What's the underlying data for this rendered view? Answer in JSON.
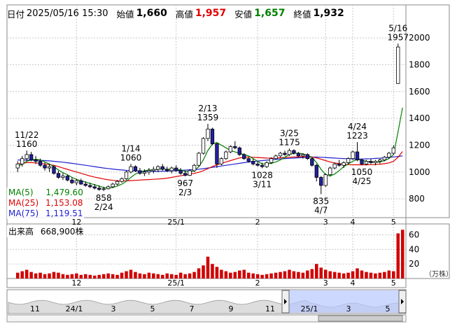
{
  "header": {
    "date_label": "日付",
    "date_value": "2025/05/16 15:30",
    "open_label": "始値",
    "open_value": "1,660",
    "high_label": "高値",
    "high_value": "1,957",
    "low_label": "安値",
    "low_value": "1,657",
    "close_label": "終値",
    "close_value": "1,932"
  },
  "ma_legend": [
    {
      "label": "MA(5)",
      "value": "1,479.60",
      "color": "#008000"
    },
    {
      "label": "MA(25)",
      "value": "1,153.08",
      "color": "#e00000"
    },
    {
      "label": "MA(75)",
      "value": "1,119.51",
      "color": "#2020d0"
    }
  ],
  "volume_legend": {
    "label": "出来高",
    "value": "668,900株"
  },
  "volume_unit": "（万株）",
  "colors": {
    "up": "#e00000",
    "down": "#2020a0",
    "ma5": "#008000",
    "ma25": "#e00000",
    "ma75": "#2020d0",
    "volume": "#d00000",
    "grid": "#c8c8c8"
  },
  "chart_data": [
    {
      "type": "candlestick",
      "title": "",
      "ylim": [
        660,
        2110
      ],
      "y_ticks": [
        "800",
        "1000",
        "1200",
        "1400",
        "1600",
        "1800",
        "2000"
      ],
      "x_ticks": [
        "12",
        "25/1",
        "2",
        "3",
        "4",
        "5"
      ],
      "grid": true,
      "annotations": [
        {
          "date": "11/22",
          "value": "1160",
          "kind": "high"
        },
        {
          "date": "2/24",
          "value": "858",
          "kind": "low"
        },
        {
          "date": "1/14",
          "value": "1060",
          "kind": "high"
        },
        {
          "date": "2/3",
          "value": "967",
          "kind": "low"
        },
        {
          "date": "2/13",
          "value": "1359",
          "kind": "high"
        },
        {
          "date": "3/11",
          "value": "1028",
          "kind": "low"
        },
        {
          "date": "3/25",
          "value": "1175",
          "kind": "high"
        },
        {
          "date": "4/7",
          "value": "835",
          "kind": "low"
        },
        {
          "date": "4/24",
          "value": "1223",
          "kind": "high"
        },
        {
          "date": "4/25",
          "value": "1050",
          "kind": "low"
        },
        {
          "date": "5/16",
          "value": "1957",
          "kind": "high"
        }
      ],
      "candles": [
        [
          1030,
          1080,
          1000,
          1060
        ],
        [
          1060,
          1120,
          1040,
          1100
        ],
        [
          1100,
          1160,
          1080,
          1130
        ],
        [
          1130,
          1150,
          1080,
          1090
        ],
        [
          1090,
          1120,
          1060,
          1080
        ],
        [
          1080,
          1100,
          1040,
          1050
        ],
        [
          1050,
          1070,
          1010,
          1030
        ],
        [
          1030,
          1060,
          1000,
          1040
        ],
        [
          1040,
          1050,
          980,
          990
        ],
        [
          990,
          1010,
          950,
          960
        ],
        [
          960,
          990,
          940,
          970
        ],
        [
          970,
          980,
          930,
          940
        ],
        [
          940,
          960,
          910,
          920
        ],
        [
          920,
          950,
          900,
          935
        ],
        [
          935,
          950,
          905,
          910
        ],
        [
          910,
          930,
          890,
          900
        ],
        [
          900,
          920,
          880,
          890
        ],
        [
          890,
          910,
          870,
          880
        ],
        [
          880,
          900,
          860,
          870
        ],
        [
          870,
          890,
          858,
          875
        ],
        [
          875,
          900,
          870,
          890
        ],
        [
          890,
          920,
          880,
          910
        ],
        [
          910,
          940,
          900,
          930
        ],
        [
          930,
          960,
          920,
          950
        ],
        [
          950,
          1010,
          940,
          1000
        ],
        [
          1000,
          1060,
          990,
          1040
        ],
        [
          1040,
          1050,
          1000,
          1010
        ],
        [
          1010,
          1030,
          980,
          990
        ],
        [
          990,
          1020,
          970,
          1000
        ],
        [
          1000,
          1030,
          980,
          1010
        ],
        [
          1010,
          1040,
          990,
          1020
        ],
        [
          1020,
          1050,
          1000,
          1040
        ],
        [
          1040,
          1060,
          1010,
          1020
        ],
        [
          1020,
          1040,
          1000,
          1010
        ],
        [
          1010,
          1040,
          990,
          1030
        ],
        [
          1030,
          1050,
          1000,
          1010
        ],
        [
          1010,
          1030,
          980,
          990
        ],
        [
          990,
          1010,
          967,
          975
        ],
        [
          975,
          1020,
          970,
          1010
        ],
        [
          1010,
          1060,
          1000,
          1050
        ],
        [
          1050,
          1150,
          1040,
          1140
        ],
        [
          1140,
          1260,
          1130,
          1250
        ],
        [
          1250,
          1359,
          1230,
          1320
        ],
        [
          1320,
          1330,
          1200,
          1210
        ],
        [
          1210,
          1220,
          1030,
          1060
        ],
        [
          1060,
          1110,
          1050,
          1100
        ],
        [
          1100,
          1160,
          1090,
          1150
        ],
        [
          1150,
          1200,
          1140,
          1190
        ],
        [
          1190,
          1230,
          1170,
          1180
        ],
        [
          1180,
          1190,
          1120,
          1130
        ],
        [
          1130,
          1140,
          1090,
          1100
        ],
        [
          1100,
          1110,
          1070,
          1080
        ],
        [
          1080,
          1100,
          1050,
          1060
        ],
        [
          1060,
          1080,
          1040,
          1050
        ],
        [
          1050,
          1070,
          1028,
          1040
        ],
        [
          1040,
          1080,
          1030,
          1070
        ],
        [
          1070,
          1110,
          1060,
          1100
        ],
        [
          1100,
          1130,
          1090,
          1120
        ],
        [
          1120,
          1150,
          1110,
          1140
        ],
        [
          1140,
          1160,
          1120,
          1130
        ],
        [
          1130,
          1175,
          1120,
          1160
        ],
        [
          1160,
          1170,
          1130,
          1140
        ],
        [
          1140,
          1150,
          1110,
          1120
        ],
        [
          1120,
          1140,
          1100,
          1130
        ],
        [
          1130,
          1140,
          1090,
          1100
        ],
        [
          1100,
          1110,
          1040,
          1050
        ],
        [
          1050,
          1060,
          930,
          960
        ],
        [
          960,
          970,
          835,
          900
        ],
        [
          900,
          990,
          890,
          980
        ],
        [
          980,
          1040,
          970,
          1030
        ],
        [
          1030,
          1070,
          1020,
          1060
        ],
        [
          1060,
          1090,
          1040,
          1050
        ],
        [
          1050,
          1080,
          1030,
          1070
        ],
        [
          1070,
          1110,
          1060,
          1100
        ],
        [
          1100,
          1160,
          1090,
          1150
        ],
        [
          1150,
          1223,
          1080,
          1090
        ],
        [
          1090,
          1100,
          1050,
          1060
        ],
        [
          1060,
          1090,
          1050,
          1080
        ],
        [
          1080,
          1100,
          1060,
          1070
        ],
        [
          1070,
          1090,
          1050,
          1080
        ],
        [
          1080,
          1100,
          1060,
          1090
        ],
        [
          1090,
          1120,
          1080,
          1110
        ],
        [
          1110,
          1150,
          1100,
          1140
        ],
        [
          1140,
          1200,
          1130,
          1180
        ],
        [
          1660,
          1957,
          1657,
          1932
        ]
      ],
      "ma5": [
        1040,
        1060,
        1080,
        1090,
        1095,
        1090,
        1075,
        1060,
        1040,
        1015,
        995,
        980,
        960,
        945,
        935,
        925,
        915,
        905,
        895,
        885,
        880,
        885,
        895,
        910,
        930,
        960,
        985,
        1000,
        1010,
        1015,
        1015,
        1020,
        1025,
        1020,
        1020,
        1020,
        1015,
        1005,
        1000,
        1010,
        1040,
        1090,
        1160,
        1210,
        1220,
        1200,
        1180,
        1160,
        1150,
        1140,
        1130,
        1120,
        1100,
        1080,
        1060,
        1060,
        1065,
        1075,
        1090,
        1110,
        1130,
        1140,
        1140,
        1135,
        1125,
        1110,
        1070,
        1020,
        980,
        970,
        985,
        1010,
        1040,
        1060,
        1080,
        1095,
        1090,
        1080,
        1075,
        1072,
        1075,
        1085,
        1100,
        1130,
        1300,
        1480
      ],
      "ma25": [
        1060,
        1065,
        1070,
        1070,
        1068,
        1065,
        1060,
        1055,
        1050,
        1040,
        1030,
        1020,
        1010,
        1000,
        990,
        980,
        970,
        962,
        955,
        948,
        942,
        938,
        935,
        934,
        934,
        936,
        938,
        940,
        942,
        944,
        946,
        948,
        950,
        954,
        960,
        966,
        972,
        978,
        984,
        990,
        998,
        1010,
        1025,
        1040,
        1055,
        1065,
        1075,
        1085,
        1095,
        1105,
        1110,
        1112,
        1110,
        1108,
        1106,
        1104,
        1103,
        1104,
        1106,
        1108,
        1110,
        1112,
        1113,
        1114,
        1114,
        1112,
        1105,
        1095,
        1085,
        1075,
        1068,
        1062,
        1058,
        1055,
        1054,
        1054,
        1054,
        1054,
        1055,
        1056,
        1058,
        1062,
        1068,
        1080,
        1110,
        1153
      ],
      "ma75": [
        1090,
        1090,
        1090,
        1089,
        1088,
        1087,
        1085,
        1083,
        1080,
        1077,
        1073,
        1069,
        1065,
        1060,
        1055,
        1050,
        1045,
        1040,
        1035,
        1030,
        1026,
        1022,
        1018,
        1015,
        1012,
        1010,
        1008,
        1006,
        1005,
        1005,
        1005,
        1005,
        1006,
        1007,
        1008,
        1010,
        1012,
        1014,
        1016,
        1018,
        1021,
        1025,
        1030,
        1035,
        1040,
        1045,
        1050,
        1055,
        1060,
        1065,
        1070,
        1074,
        1078,
        1082,
        1085,
        1088,
        1091,
        1094,
        1097,
        1100,
        1102,
        1104,
        1106,
        1108,
        1110,
        1111,
        1111,
        1110,
        1108,
        1106,
        1104,
        1102,
        1100,
        1099,
        1098,
        1097,
        1097,
        1098,
        1099,
        1101,
        1103,
        1106,
        1109,
        1112,
        1116,
        1120
      ]
    },
    {
      "type": "bar",
      "title": "",
      "ylabel": "（万株）",
      "ylim": [
        0,
        75
      ],
      "y_ticks": [
        "20",
        "40",
        "60"
      ],
      "x_ticks": [
        "12",
        "25/1",
        "2",
        "3",
        "4",
        "5"
      ],
      "values": [
        8,
        10,
        12,
        9,
        7,
        8,
        6,
        7,
        9,
        8,
        6,
        5,
        6,
        7,
        5,
        6,
        5,
        4,
        5,
        6,
        7,
        6,
        5,
        8,
        10,
        12,
        9,
        7,
        6,
        8,
        7,
        6,
        5,
        7,
        6,
        5,
        8,
        6,
        7,
        9,
        14,
        18,
        30,
        20,
        16,
        12,
        10,
        8,
        9,
        11,
        12,
        8,
        7,
        6,
        5,
        6,
        7,
        8,
        9,
        10,
        12,
        10,
        9,
        8,
        11,
        13,
        20,
        15,
        12,
        10,
        9,
        8,
        7,
        8,
        10,
        14,
        11,
        9,
        8,
        7,
        8,
        9,
        11,
        10,
        62,
        67
      ]
    },
    {
      "type": "area",
      "title": "",
      "x_ticks": [
        "11",
        "24/1",
        "3",
        "5",
        "7",
        "9",
        "11",
        "25/1",
        "3",
        "5"
      ]
    }
  ]
}
